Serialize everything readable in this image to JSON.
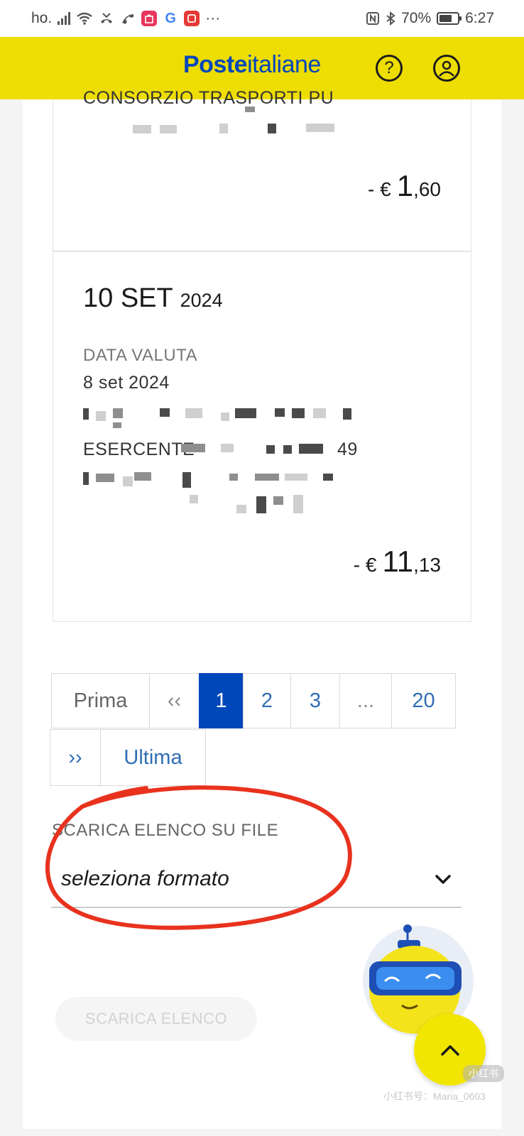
{
  "status_bar": {
    "carrier": "ho.",
    "more": "···",
    "battery": "70%",
    "battery_level": 0.7,
    "time": "6:27"
  },
  "header": {
    "logo_bold": "Poste",
    "logo_regular": "italiane",
    "help_icon": "?"
  },
  "transactions": [
    {
      "partial_text": "CONSORZIO TRASPORTI PU",
      "amount_sign": "- €",
      "amount_int": "1",
      "amount_dec": ",60"
    },
    {
      "date_day_month": "10 SET",
      "date_year": "2024",
      "valuta_label": "DATA VALUTA",
      "valuta_date": "8 set 2024",
      "merchant_line_start": "ESERCENTE",
      "merchant_line_end": "49",
      "amount_sign": "- €",
      "amount_int": "11",
      "amount_dec": ",13"
    }
  ],
  "pagination": {
    "first": "Prima",
    "prev": "‹‹",
    "pages": [
      "1",
      "2",
      "3",
      "...",
      "20"
    ],
    "next": "››",
    "last": "Ultima",
    "active": "1"
  },
  "download": {
    "label": "SCARICA ELENCO SU FILE",
    "select_value": "seleziona formato",
    "button_label": "SCARICA ELENCO"
  },
  "scroll_top_icon": "chevron-up-icon",
  "watermark": "小红书号：Maria_0603",
  "watermark_badge": "小红书",
  "colors": {
    "brand_yellow": "#eedd00",
    "brand_blue": "#0047bb",
    "annotation_red": "#e8321e"
  }
}
